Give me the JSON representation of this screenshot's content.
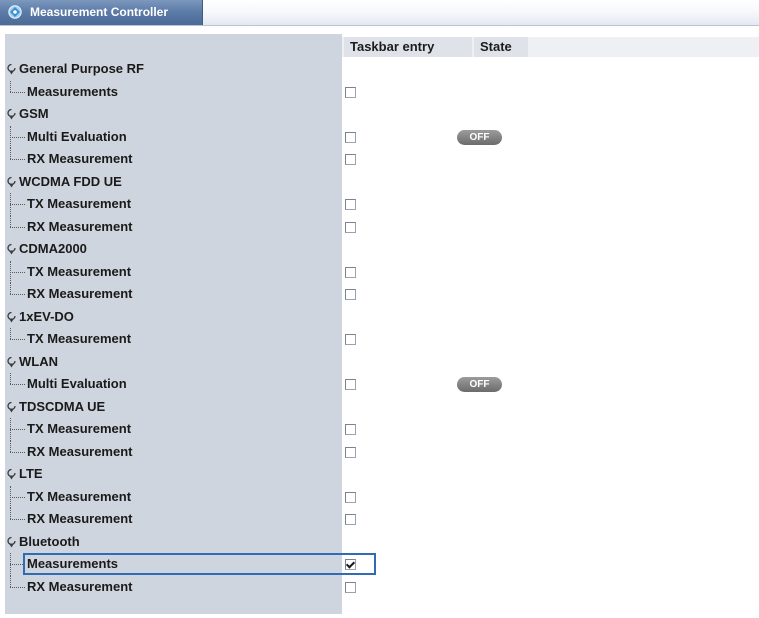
{
  "window": {
    "title": "Measurement Controller"
  },
  "columns": {
    "taskbar_entry": "Taskbar entry",
    "state": "State"
  },
  "tree": [
    {
      "group": "General Purpose RF",
      "children": [
        {
          "label": "Measurements",
          "taskbar_checked": false,
          "state": ""
        }
      ]
    },
    {
      "group": "GSM",
      "children": [
        {
          "label": "Multi Evaluation",
          "taskbar_checked": false,
          "state": "OFF"
        },
        {
          "label": "RX Measurement",
          "taskbar_checked": false,
          "state": ""
        }
      ]
    },
    {
      "group": "WCDMA FDD UE",
      "children": [
        {
          "label": "TX Measurement",
          "taskbar_checked": false,
          "state": ""
        },
        {
          "label": "RX Measurement",
          "taskbar_checked": false,
          "state": ""
        }
      ]
    },
    {
      "group": "CDMA2000",
      "children": [
        {
          "label": "TX Measurement",
          "taskbar_checked": false,
          "state": ""
        },
        {
          "label": "RX Measurement",
          "taskbar_checked": false,
          "state": ""
        }
      ]
    },
    {
      "group": "1xEV-DO",
      "children": [
        {
          "label": "TX Measurement",
          "taskbar_checked": false,
          "state": ""
        }
      ]
    },
    {
      "group": "WLAN",
      "children": [
        {
          "label": "Multi Evaluation",
          "taskbar_checked": false,
          "state": "OFF"
        }
      ]
    },
    {
      "group": "TDSCDMA UE",
      "children": [
        {
          "label": "TX Measurement",
          "taskbar_checked": false,
          "state": ""
        },
        {
          "label": "RX Measurement",
          "taskbar_checked": false,
          "state": ""
        }
      ]
    },
    {
      "group": "LTE",
      "children": [
        {
          "label": "TX Measurement",
          "taskbar_checked": false,
          "state": ""
        },
        {
          "label": "RX Measurement",
          "taskbar_checked": false,
          "state": ""
        }
      ]
    },
    {
      "group": "Bluetooth",
      "children": [
        {
          "label": "Measurements",
          "taskbar_checked": true,
          "state": "",
          "selected": true
        },
        {
          "label": "RX Measurement",
          "taskbar_checked": false,
          "state": ""
        }
      ]
    }
  ],
  "colors": {
    "title_tab": "#5d7ca8",
    "tree_panel": "#cfd5de",
    "selection": "#2f6cb4",
    "off_badge": "#7d7d7d"
  }
}
